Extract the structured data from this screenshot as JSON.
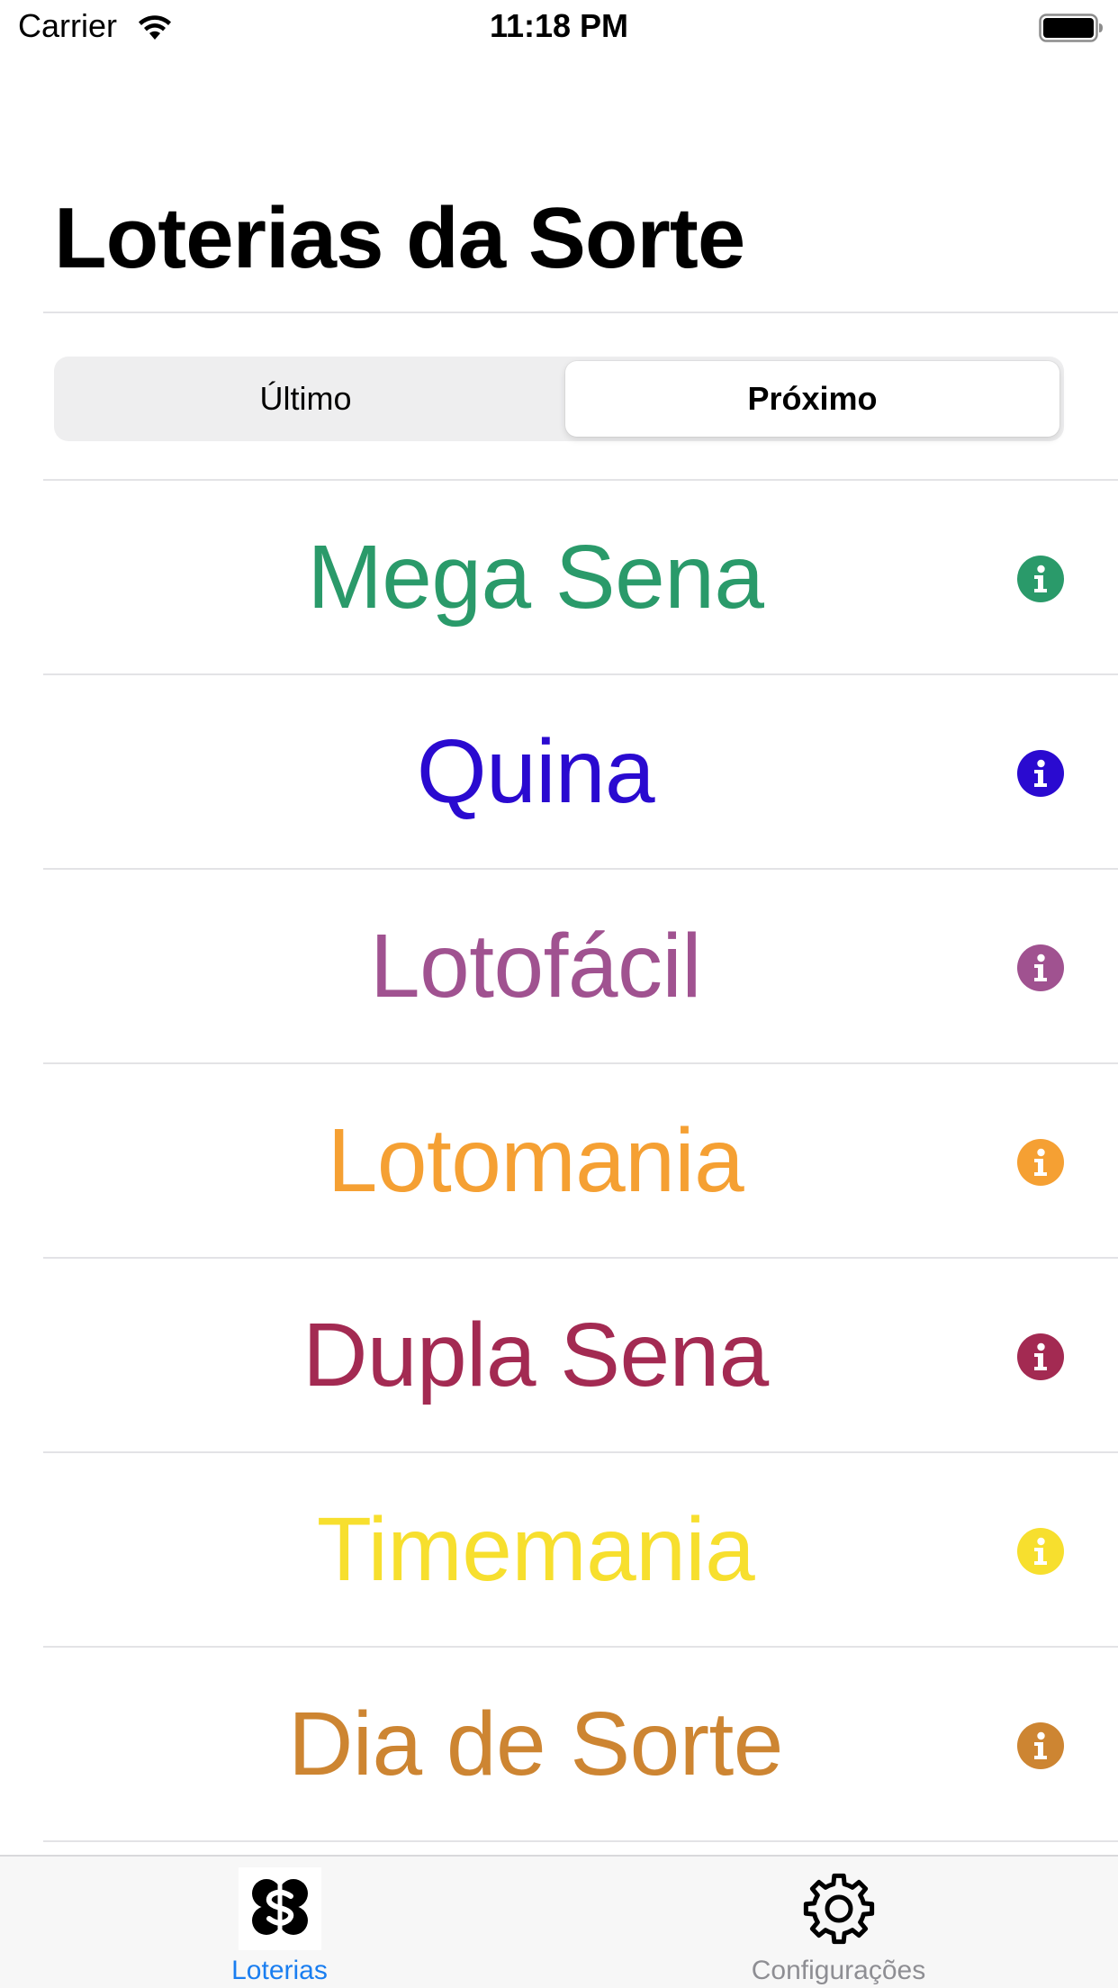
{
  "status_bar": {
    "carrier": "Carrier",
    "time": "11:18 PM",
    "icons": [
      "wifi-icon",
      "battery-icon"
    ]
  },
  "header": {
    "title": "Loterias da Sorte"
  },
  "segmented_control": {
    "options": [
      "Último",
      "Próximo"
    ],
    "selected": "Próximo"
  },
  "lotteries": [
    {
      "name": "Mega Sena",
      "color": "#209869",
      "icon": "info-icon"
    },
    {
      "name": "Quina",
      "color": "#260085",
      "icon": "info-icon"
    },
    {
      "name": "Lotofácil",
      "color": "#930089",
      "icon": "info-icon"
    },
    {
      "name": "Lotomania",
      "color": "#f78100",
      "icon": "info-icon"
    },
    {
      "name": "Dupla Sena",
      "color": "#a61324",
      "icon": "info-icon"
    },
    {
      "name": "Timemania",
      "color": "#fff600",
      "icon": "info-icon"
    },
    {
      "name": "Dia de Sorte",
      "color": "#cb852b",
      "icon": "info-icon"
    }
  ],
  "lottery_display_colors": [
    "#2a9a6a",
    "#2a0ad0",
    "#a05290",
    "#f5a033",
    "#a32a52",
    "#f7df2e",
    "#cd8532"
  ],
  "tab_bar": {
    "tabs": [
      {
        "label": "Loterias",
        "icon": "clover-dollar-icon",
        "active": true,
        "color": "#1a7ef0"
      },
      {
        "label": "Configurações",
        "icon": "gear-icon",
        "active": false,
        "color": "#8e8e93"
      }
    ]
  }
}
